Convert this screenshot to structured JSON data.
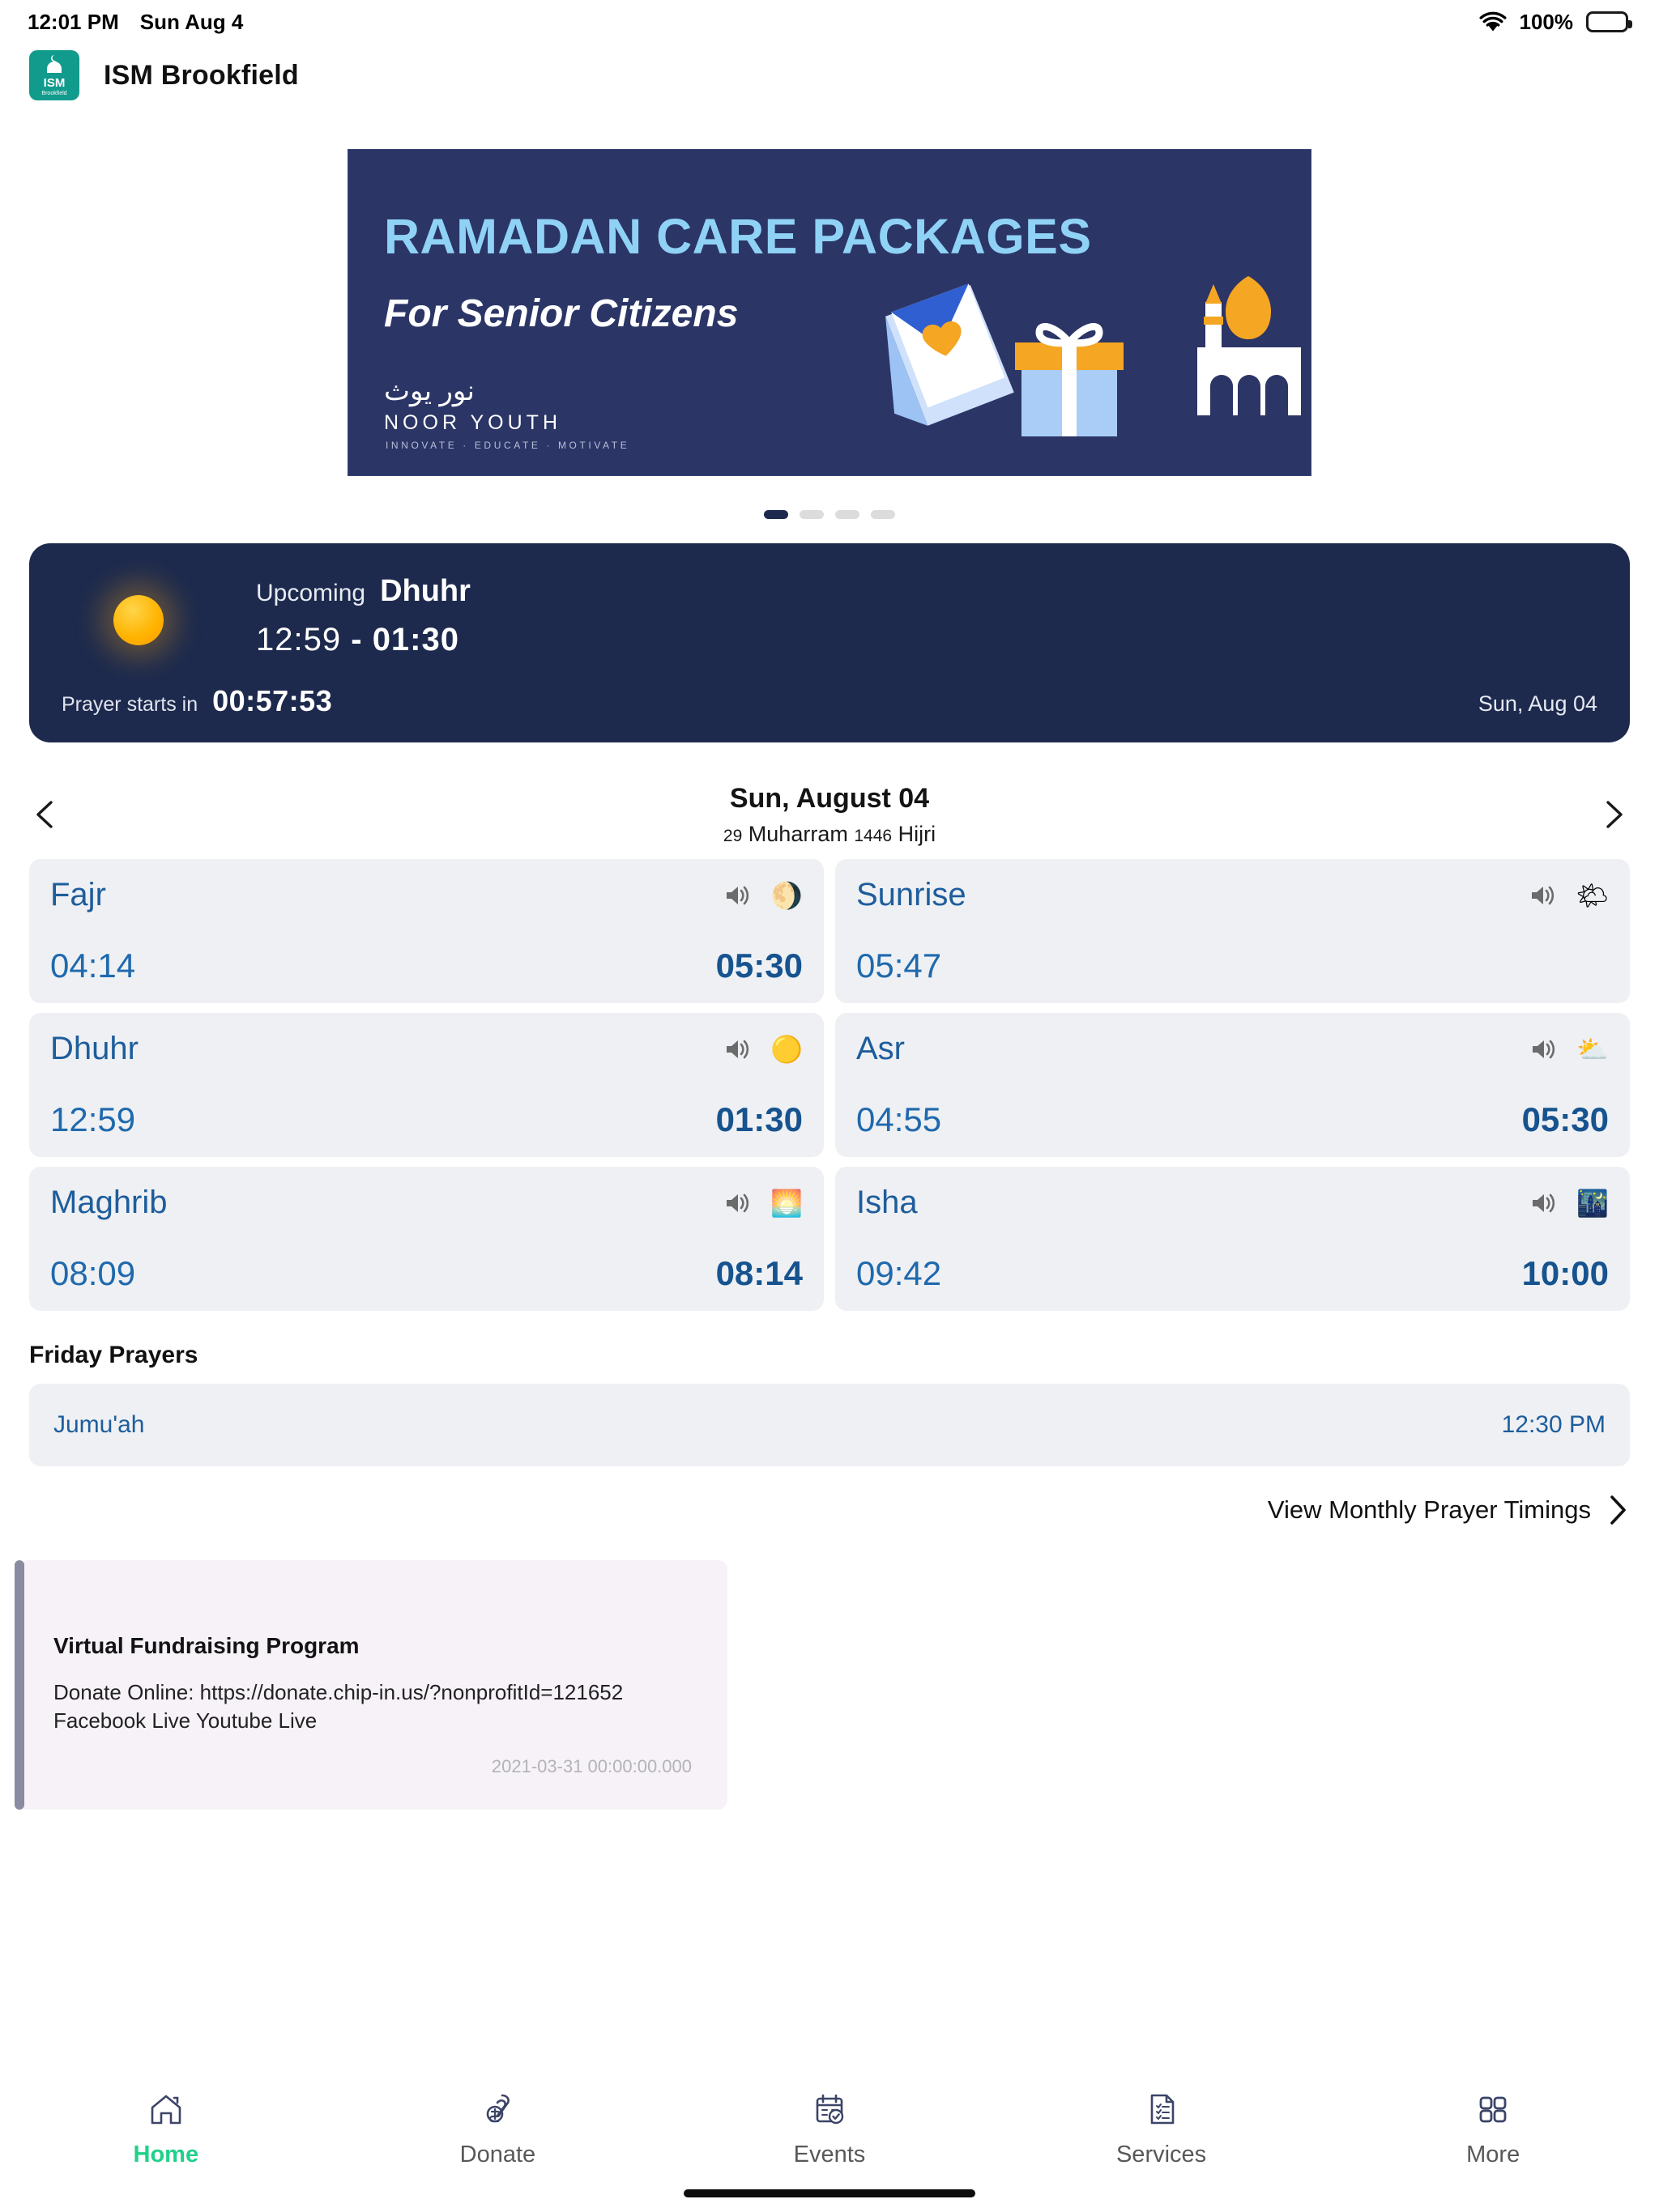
{
  "status_bar": {
    "time": "12:01 PM",
    "date": "Sun Aug 4",
    "battery_percent": "100%",
    "wifi_icon": "wifi-icon",
    "battery_icon": "battery-full-icon"
  },
  "header": {
    "title": "ISM Brookfield",
    "logo_text": "ISM",
    "logo_sub": "Brookfield"
  },
  "carousel": {
    "banner": {
      "title": "RAMADAN CARE PACKAGES",
      "subtitle": "For Senior Citizens",
      "arabic": "نور يوث",
      "brand": "NOOR YOUTH",
      "tagline": "INNOVATE · EDUCATE · MOTIVATE"
    },
    "dots": [
      {
        "active": true
      },
      {
        "active": false
      },
      {
        "active": false
      },
      {
        "active": false
      }
    ]
  },
  "upcoming": {
    "icon": "sun-icon",
    "label": "Upcoming",
    "name": "Dhuhr",
    "start": "12:59",
    "separator": "-",
    "end": "01:30",
    "countdown_label": "Prayer starts in",
    "countdown": "00:57:53",
    "date": "Sun, Aug 04"
  },
  "date_nav": {
    "prev_icon": "chevron-left-icon",
    "next_icon": "chevron-right-icon",
    "gregorian": "Sun, August 04",
    "hijri_day": "29",
    "hijri_month": "Muharram",
    "hijri_year": "1446",
    "hijri_suffix": "Hijri"
  },
  "prayers": [
    {
      "name": "Fajr",
      "start": "04:14",
      "iqamah": "05:30",
      "speaker_icon": "speaker-icon",
      "weather_icon": "moon-behind-cloud-icon",
      "glyph": "🌖"
    },
    {
      "name": "Sunrise",
      "start": "05:47",
      "iqamah": "",
      "speaker_icon": "speaker-icon",
      "weather_icon": "sunrise-over-cloud-icon",
      "glyph": "🌤"
    },
    {
      "name": "Dhuhr",
      "start": "12:59",
      "iqamah": "01:30",
      "speaker_icon": "speaker-icon",
      "weather_icon": "sun-icon",
      "glyph": "🟡"
    },
    {
      "name": "Asr",
      "start": "04:55",
      "iqamah": "05:30",
      "speaker_icon": "speaker-icon",
      "weather_icon": "sun-behind-cloud-icon",
      "glyph": "⛅"
    },
    {
      "name": "Maghrib",
      "start": "08:09",
      "iqamah": "08:14",
      "speaker_icon": "speaker-icon",
      "weather_icon": "sunset-icon",
      "glyph": "🌅"
    },
    {
      "name": "Isha",
      "start": "09:42",
      "iqamah": "10:00",
      "speaker_icon": "speaker-icon",
      "weather_icon": "crescent-moon-stars-icon",
      "glyph": "🌃"
    }
  ],
  "friday": {
    "heading": "Friday Prayers",
    "rows": [
      {
        "name": "Jumu'ah",
        "time": "12:30 PM"
      }
    ]
  },
  "monthly_link": {
    "label": "View Monthly Prayer Timings",
    "icon": "chevron-right-icon"
  },
  "announcement": {
    "title": "Virtual Fundraising Program",
    "body": "Donate Online: https://donate.chip-in.us/?nonprofitId=121652 Facebook Live Youtube Live",
    "timestamp": "2021-03-31 00:00:00.000"
  },
  "tabbar": {
    "items": [
      {
        "label": "Home",
        "icon": "home-icon",
        "active": true
      },
      {
        "label": "Donate",
        "icon": "donate-hand-icon",
        "active": false
      },
      {
        "label": "Events",
        "icon": "calendar-check-icon",
        "active": false
      },
      {
        "label": "Services",
        "icon": "document-list-icon",
        "active": false
      },
      {
        "label": "More",
        "icon": "grid-squares-icon",
        "active": false
      }
    ]
  },
  "colors": {
    "navy": "#1d2a4d",
    "card_bg": "#eef0f3",
    "prayer_blue": "#1e5d9c",
    "accent_green": "#1fd18a",
    "banner_bg": "#2b3566",
    "banner_title": "#8fd2f5"
  }
}
